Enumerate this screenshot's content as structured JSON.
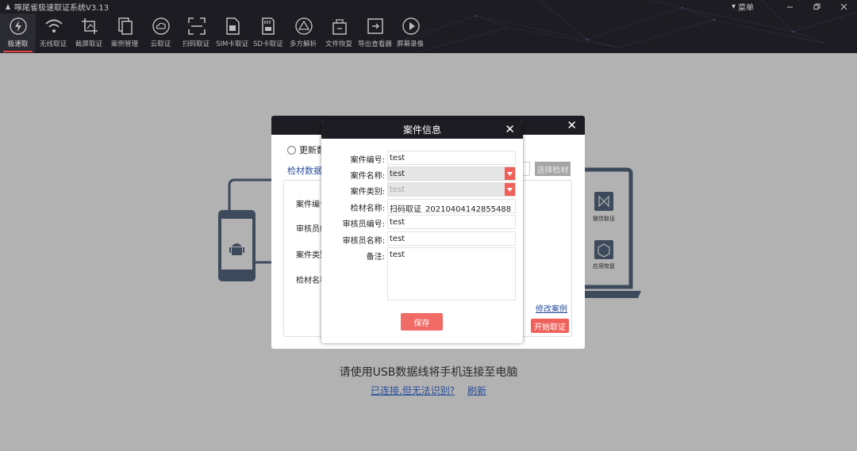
{
  "app": {
    "title": "啄尾雀极速取证系统V3.13",
    "menu_label": "菜单"
  },
  "toolbar": [
    {
      "label": "极速取",
      "icon": "lightning-icon"
    },
    {
      "label": "无线取证",
      "icon": "wifi-icon"
    },
    {
      "label": "截屏取证",
      "icon": "crop-icon"
    },
    {
      "label": "案例管理",
      "icon": "copy-icon"
    },
    {
      "label": "云取证",
      "icon": "cloud-icon"
    },
    {
      "label": "扫码取证",
      "icon": "scan-icon"
    },
    {
      "label": "SIM卡取证",
      "icon": "sim-card-icon"
    },
    {
      "label": "SD卡取证",
      "icon": "sd-card-icon"
    },
    {
      "label": "多方解析",
      "icon": "triangle-icon"
    },
    {
      "label": "文件恢复",
      "icon": "file-restore-icon"
    },
    {
      "label": "导出查看器",
      "icon": "export-icon"
    },
    {
      "label": "屏幕录像",
      "icon": "play-icon"
    }
  ],
  "main": {
    "usb_hint": "请使用USB数据线将手机连接至电脑",
    "connected_link": "已连接,但无法识别?",
    "refresh_link": "刷新",
    "side_icons": {
      "micro": "微信取证",
      "app": "应用恢复"
    }
  },
  "back_dialog": {
    "radio_label": "更新数",
    "source_label": "检材数据:",
    "pick_button": "选择检材",
    "labels": [
      "案件编号",
      "审核员编号",
      "案件类别",
      "检材名称"
    ],
    "edit_link": "修改案例",
    "start_button": "开始取证"
  },
  "case_dialog": {
    "title": "案件信息",
    "fields": {
      "case_no": {
        "label": "案件编号:",
        "value": "test"
      },
      "case_name": {
        "label": "案件名称:",
        "value": "test"
      },
      "case_type": {
        "label": "案件类别:",
        "value": "test"
      },
      "material": {
        "label": "检材名称:",
        "value": "扫码取证_20210404142855488"
      },
      "auditor_no": {
        "label": "审核员编号:",
        "value": "test"
      },
      "auditor_name": {
        "label": "审核员名称:",
        "value": "test"
      },
      "remark": {
        "label": "备注:",
        "value": "test"
      }
    },
    "save_button": "保存"
  },
  "colors": {
    "accent": "#f0605a",
    "header": "#1c1c22",
    "link": "#2a4f9a",
    "overlay": "#b2b2b2"
  }
}
